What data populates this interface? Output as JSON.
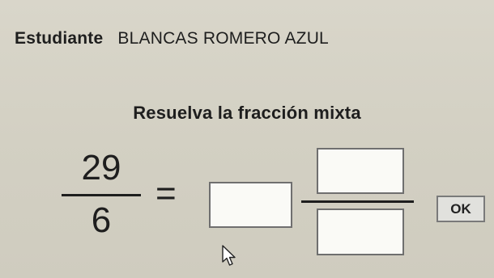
{
  "header": {
    "student_label": "Estudiante",
    "student_name": "BLANCAS ROMERO AZUL"
  },
  "exercise": {
    "instruction": "Resuelva la fracción mixta",
    "given_numerator": "29",
    "given_denominator": "6",
    "equals": "=",
    "whole_value": "",
    "numerator_value": "",
    "denominator_value": ""
  },
  "actions": {
    "ok_label": "OK"
  },
  "icons": {
    "cursor": "mouse-pointer-icon"
  },
  "colors": {
    "background": "#d6d3c7",
    "text": "#1e1e1e",
    "input_fill": "#fafaf6",
    "input_border": "#6f6f6f",
    "button_fill": "#e1e1dd"
  }
}
